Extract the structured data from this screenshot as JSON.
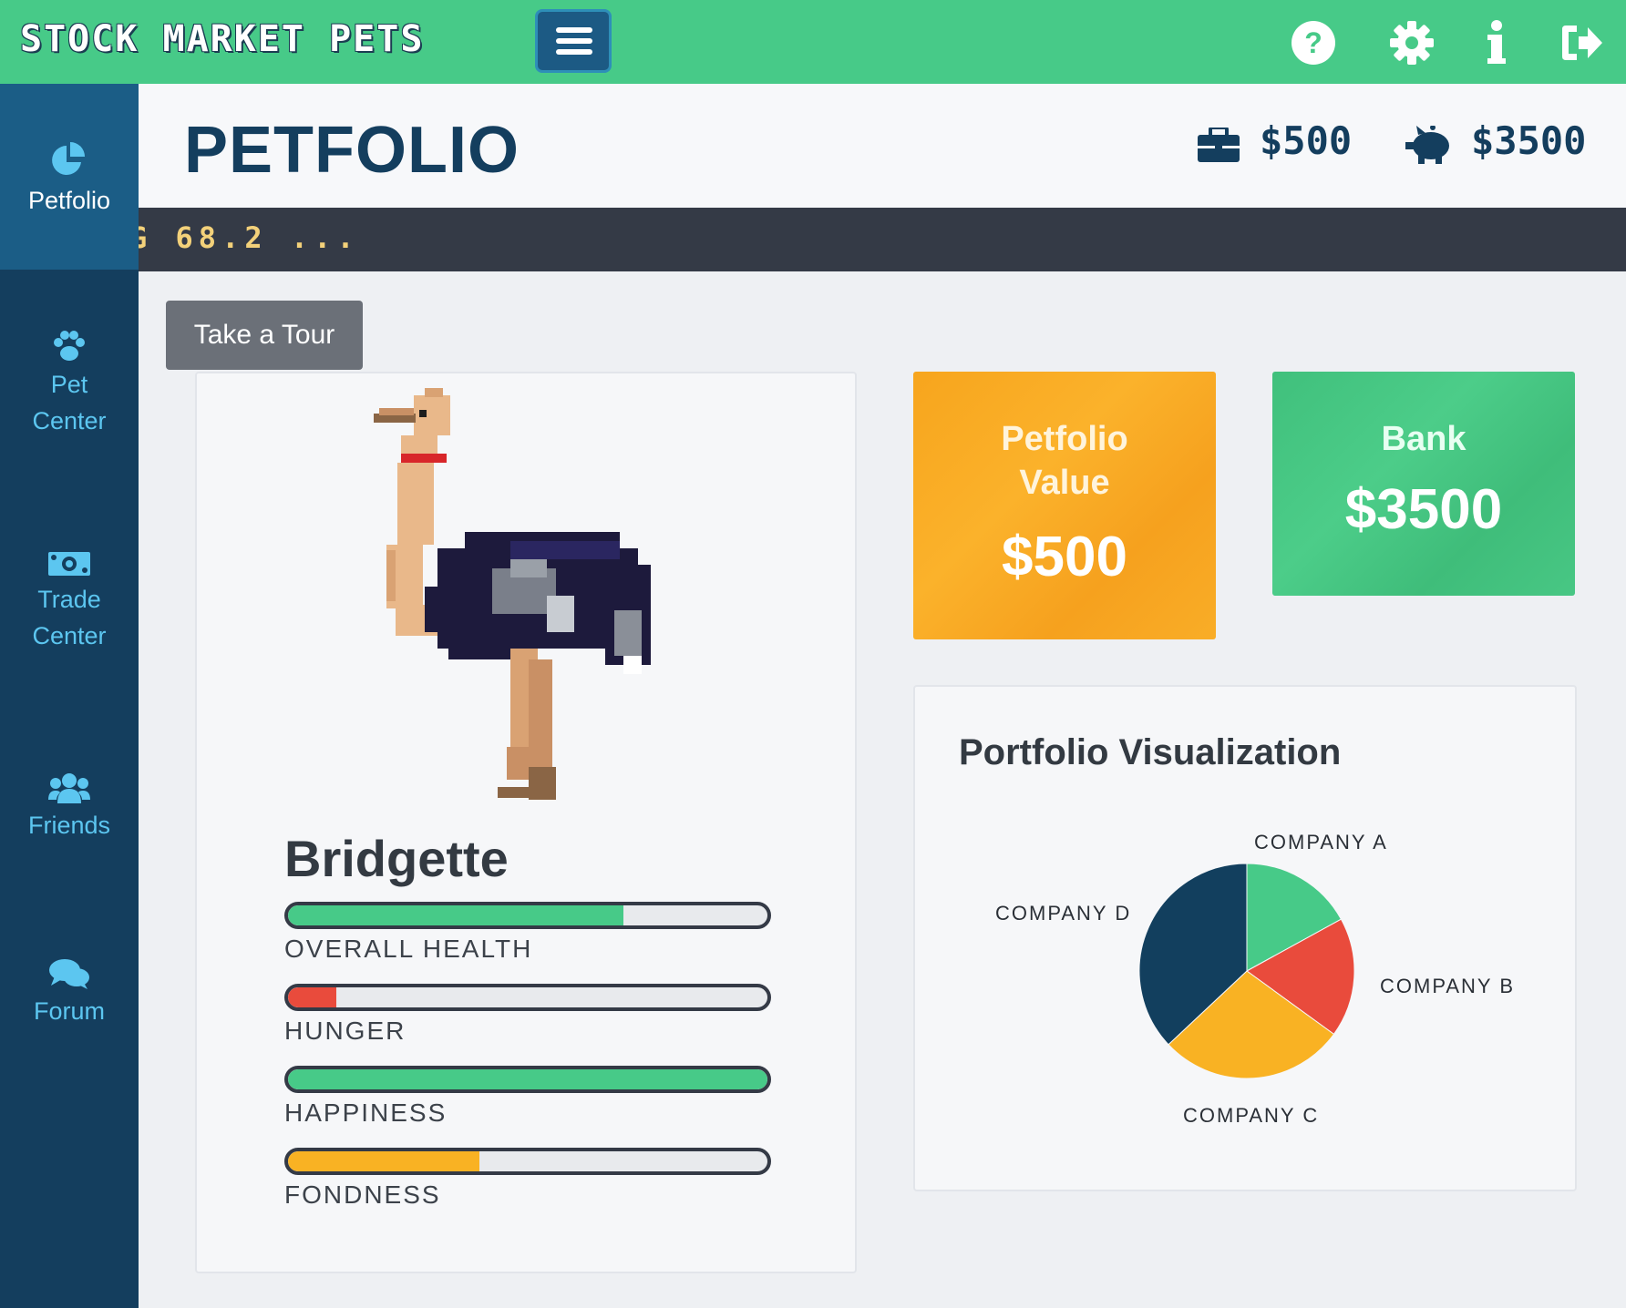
{
  "app": {
    "title": "STOCK MARKET PETS"
  },
  "topbar": {
    "icons": [
      "help-icon",
      "settings-gear-icon",
      "info-icon",
      "logout-icon"
    ],
    "accent": "#47ca88"
  },
  "sidebar": {
    "items": [
      {
        "label": "Petfolio",
        "icon": "pie-chart-icon",
        "active": true
      },
      {
        "label": "Pet Center",
        "icon": "paw-icon",
        "active": false
      },
      {
        "label": "Trade Center",
        "icon": "money-icon",
        "active": false
      },
      {
        "label": "Friends",
        "icon": "users-icon",
        "active": false
      },
      {
        "label": "Forum",
        "icon": "chat-icon",
        "active": false
      }
    ]
  },
  "header": {
    "title": "PETFOLIO",
    "portfolio_amount": "$500",
    "bank_amount": "$3500"
  },
  "ticker": {
    "text": "G 68.2 ..."
  },
  "tour_button": "Take a Tour",
  "pet": {
    "name": "Bridgette",
    "stats": [
      {
        "label": "OVERALL HEALTH",
        "value": 0.7,
        "color": "#47ca88"
      },
      {
        "label": "HUNGER",
        "value": 0.1,
        "color": "#e94b3c"
      },
      {
        "label": "HAPPINESS",
        "value": 1.0,
        "color": "#47ca88"
      },
      {
        "label": "FONDNESS",
        "value": 0.4,
        "color": "#f9b223"
      }
    ]
  },
  "cards": {
    "petfolio": {
      "title_line1": "Petfolio",
      "title_line2": "Value",
      "amount": "$500",
      "color": "#f9a825"
    },
    "bank": {
      "title": "Bank",
      "amount": "$3500",
      "color": "#44c37e"
    }
  },
  "viz": {
    "title": "Portfolio Visualization"
  },
  "chart_data": {
    "type": "pie",
    "title": "Portfolio Visualization",
    "categories": [
      "COMPANY A",
      "COMPANY B",
      "COMPANY C",
      "COMPANY D"
    ],
    "values": [
      17,
      18,
      28,
      37
    ],
    "colors": [
      "#47ca88",
      "#e94b3c",
      "#f9b223",
      "#123f5e"
    ]
  }
}
